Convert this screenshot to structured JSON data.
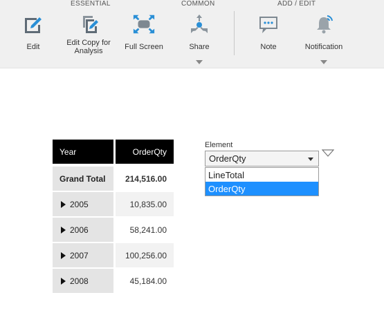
{
  "toolbar": {
    "groups": {
      "essential": "ESSENTIAL",
      "common": "COMMON",
      "add_edit": "ADD / EDIT"
    },
    "buttons": {
      "edit": "Edit",
      "edit_copy": "Edit Copy for\nAnalysis",
      "full_screen": "Full Screen",
      "share": "Share",
      "note": "Note",
      "notification": "Notification"
    },
    "colors": {
      "icon": "#5f6b76",
      "accent": "#2a8fd6"
    }
  },
  "pivot": {
    "headers": {
      "row": "Year",
      "value": "OrderQty"
    },
    "grand_total": {
      "label": "Grand Total",
      "value": "214,516.00"
    },
    "rows": [
      {
        "label": "2005",
        "value": "10,835.00"
      },
      {
        "label": "2006",
        "value": "58,241.00"
      },
      {
        "label": "2007",
        "value": "100,256.00"
      },
      {
        "label": "2008",
        "value": "45,184.00"
      }
    ]
  },
  "parameter": {
    "label": "Element",
    "selected": "OrderQty",
    "options": [
      "LineTotal",
      "OrderQty"
    ]
  }
}
